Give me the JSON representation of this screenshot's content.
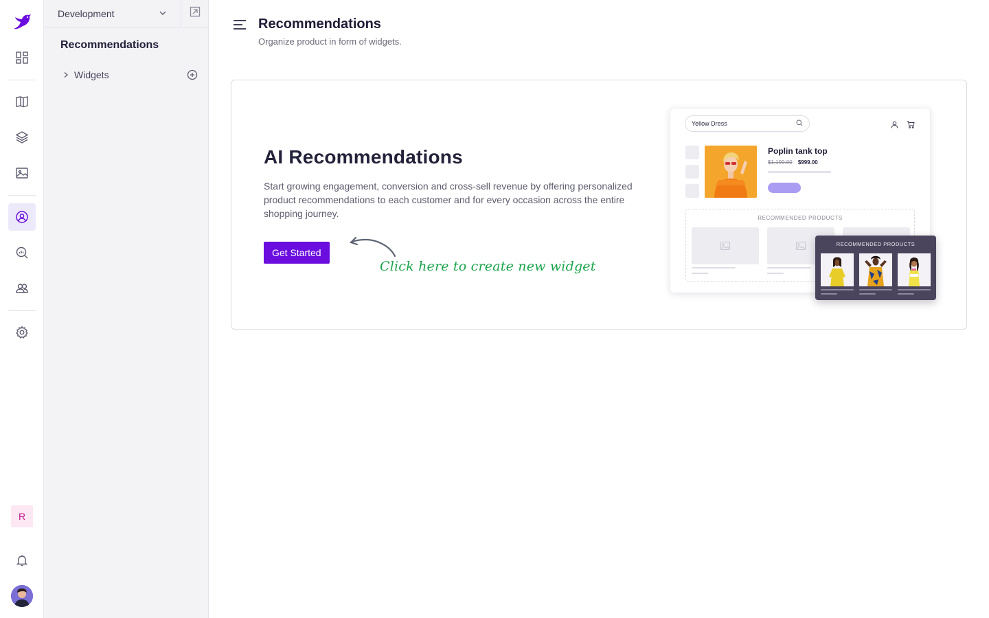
{
  "sidebar": {
    "environment": "Development",
    "section_title": "Recommendations",
    "tree": [
      {
        "label": "Widgets"
      }
    ],
    "org_initial": "R"
  },
  "icons": {
    "rail": [
      "logo-bird-icon",
      "dashboard-icon",
      "catalog-book-icon",
      "layers-icon",
      "image-icon",
      "recommendations-icon",
      "analytics-search-icon",
      "users-icon",
      "settings-gear-icon",
      "bell-icon"
    ],
    "sidebar": [
      "chevron-down-icon",
      "open-external-icon",
      "chevron-right-icon",
      "add-circle-icon"
    ],
    "header": [
      "menu-hamburger-icon"
    ]
  },
  "header": {
    "title": "Recommendations",
    "subtitle": "Organize product in form of widgets."
  },
  "hero": {
    "heading": "AI Recommendations",
    "description": "Start growing engagement, conversion and cross-sell revenue by offering personalized product recommendations to each customer and for every occasion across the entire shopping journey.",
    "cta_label": "Get Started",
    "hint": "Click here to create new widget"
  },
  "illustration": {
    "search_value": "Yellow Dress",
    "product_name": "Poplin tank top",
    "old_price": "$1,199.00",
    "new_price": "$999.00",
    "recommended_title": "RECOMMENDED PRODUCTS",
    "popup_title": "RECOMMENDED PRODUCTS"
  },
  "colors": {
    "brand": "#6a0dde",
    "active_nav_bg": "#ece9fb",
    "hint_green": "#19a34a",
    "org_badge_bg": "#fde7f3",
    "org_badge_fg": "#c2168a"
  }
}
